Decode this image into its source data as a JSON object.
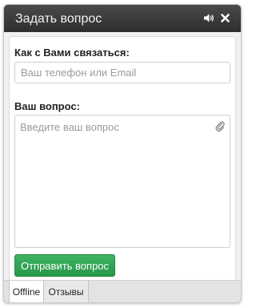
{
  "window": {
    "title": "Задать вопрос",
    "icons": {
      "sound": "speaker-icon",
      "close": "close-icon"
    }
  },
  "form": {
    "contact_label": "Как с Вами связаться:",
    "contact_placeholder": "Ваш телефон или Email",
    "contact_value": "",
    "question_label": "Ваш вопрос:",
    "question_placeholder": "Введите ваш вопрос",
    "question_value": "",
    "attach_icon": "paperclip-icon",
    "send_label": "Отправить вопрос"
  },
  "tabs": [
    {
      "label": "Offline",
      "active": true
    },
    {
      "label": "Отзывы",
      "active": false
    }
  ],
  "colors": {
    "titlebar": "#333333",
    "send_button": "#2ea552",
    "panel": "#ffffff"
  }
}
